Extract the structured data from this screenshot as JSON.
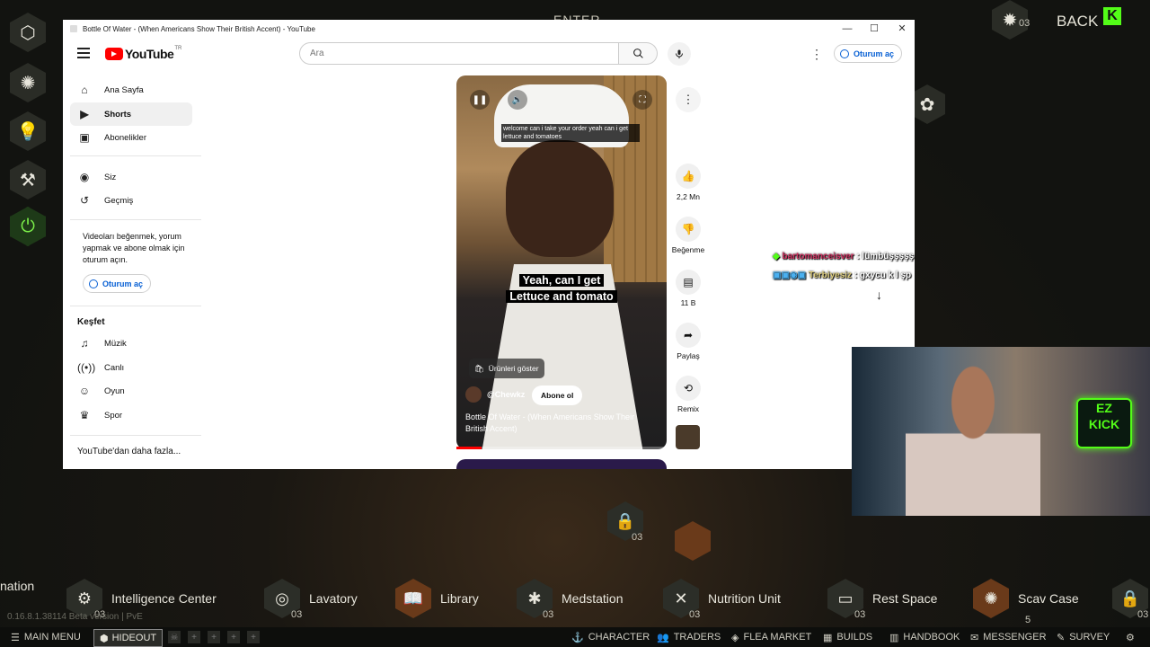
{
  "game": {
    "top_enter": "ENTER",
    "back_label": "BACK",
    "kick_logo": "K",
    "top_level_a": "03",
    "top_level_b": "03",
    "ez_kick": [
      "EZ",
      "KICK"
    ],
    "version": "0.16.8.1.38114 Beta version | PvE",
    "center_level": "03",
    "modules": [
      {
        "label": "nation",
        "level": ""
      },
      {
        "label": "Intelligence Center",
        "level": "03"
      },
      {
        "label": "Lavatory",
        "level": "03"
      },
      {
        "label": "Library",
        "level": ""
      },
      {
        "label": "Medstation",
        "level": "03"
      },
      {
        "label": "Nutrition Unit",
        "level": "03"
      },
      {
        "label": "Rest Space",
        "level": "03"
      },
      {
        "label": "Scav Case",
        "level": "5"
      },
      {
        "label": "",
        "level": "03"
      }
    ],
    "statusbar": {
      "main_menu": "MAIN MENU",
      "hideout": "HIDEOUT",
      "character": "CHARACTER",
      "traders": "TRADERS",
      "flea_market": "FLEA MARKET",
      "builds": "BUILDS",
      "handbook": "HANDBOOK",
      "messenger": "MESSENGER",
      "survey": "SURVEY"
    }
  },
  "browser": {
    "title": "Bottle Of Water - (When Americans Show Their British Accent) - YouTube",
    "controls": {
      "minimize": "—",
      "maximize": "☐",
      "close": "✕"
    }
  },
  "youtube": {
    "logo_text": "YouTube",
    "logo_country": "TR",
    "search_placeholder": "Ara",
    "signin_label": "Oturum aç",
    "nav": [
      {
        "label": "Ana Sayfa",
        "icon": "home-icon"
      },
      {
        "label": "Shorts",
        "icon": "shorts-icon",
        "active": true
      },
      {
        "label": "Abonelikler",
        "icon": "subscriptions-icon"
      },
      {
        "label": "Siz",
        "icon": "you-icon"
      },
      {
        "label": "Geçmiş",
        "icon": "history-icon"
      }
    ],
    "signin_prompt": "Videoları beğenmek, yorum yapmak ve abone olmak için oturum açın.",
    "explore_title": "Keşfet",
    "explore": [
      {
        "label": "Müzik",
        "icon": "music-icon"
      },
      {
        "label": "Canlı",
        "icon": "live-icon"
      },
      {
        "label": "Oyun",
        "icon": "gaming-icon"
      },
      {
        "label": "Spor",
        "icon": "trophy-icon"
      }
    ],
    "more_from_youtube": "YouTube'dan daha fazla...",
    "short": {
      "subtitle_top": "welcome can i take your order yeah can i get lettuce and tomatoes",
      "subtitle_big_1": "Yeah, can I get",
      "subtitle_big_2": "Lettuce and tomato",
      "products_label": "Ürünleri göster",
      "channel": "@Chewkz",
      "subscribe_label": "Abone ol",
      "title": "Bottle Of Water - (When Americans Show Their British Accent)",
      "progress": 0.12
    },
    "actions": {
      "likes": "2,2 Mn",
      "dislike": "Beğenme",
      "comments": "11 B",
      "share": "Paylaş",
      "remix": "Remix"
    }
  },
  "chat": [
    {
      "user": "bartomanceisver",
      "message": ": lümbüşşşşş"
    },
    {
      "user": "Terbiyesiz",
      "message": ": gxycu k l şp"
    }
  ],
  "colors": {
    "yt_red": "#ff0000",
    "yt_blue": "#065fd4",
    "kick_green": "#53fc18"
  }
}
